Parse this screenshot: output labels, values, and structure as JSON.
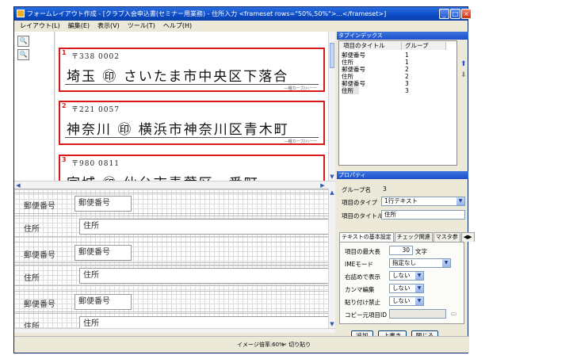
{
  "window": {
    "title": "フォームレイアウト作成 - [クラブ入会申込書(セミナー用業務) - 住所入力 <frameset rows=\"50%,50%\">...</frameset>]",
    "minimize_label": "_",
    "maximize_label": "□",
    "close_label": "×"
  },
  "menu": {
    "items": [
      "レイアウト(L)",
      "編集(E)",
      "表示(V)",
      "ツール(T)",
      "ヘルプ(H)"
    ]
  },
  "image_view": {
    "rows": [
      {
        "num": "1",
        "postal": "〒338 0002",
        "handwriting": "埼玉 ㊞ さいたま市中央区下落合",
        "fine": "―種カーブ/ハーー"
      },
      {
        "num": "2",
        "postal": "〒221 0057",
        "handwriting": "神奈川 ㊞ 横浜市神奈川区青木町",
        "fine": "―種カーブ/ハーー"
      },
      {
        "num": "3",
        "postal": "〒980 0811",
        "handwriting": "宮城 ㊞ 仙台市青葉区一番町",
        "fine": ""
      }
    ]
  },
  "form": {
    "rows": [
      {
        "label": "郵便番号",
        "value": "郵便番号"
      },
      {
        "label": "住所",
        "value": "住所"
      },
      {
        "label": "郵便番号",
        "value": "郵便番号"
      },
      {
        "label": "住所",
        "value": "住所"
      },
      {
        "label": "郵便番号",
        "value": "郵便番号"
      },
      {
        "label": "住所",
        "value": "住所"
      }
    ]
  },
  "status": {
    "zoom": "イメージ倍率:60%",
    "cut": "切り貼り"
  },
  "tab_index": {
    "title": "タブインデックス",
    "col_title": "項目のタイトル",
    "col_group": "グループ",
    "items": [
      {
        "title": "郵便番号",
        "group": "1"
      },
      {
        "title": "住所",
        "group": "1"
      },
      {
        "title": "郵便番号",
        "group": "2"
      },
      {
        "title": "住所",
        "group": "2"
      },
      {
        "title": "郵便番号",
        "group": "3"
      },
      {
        "title": "住所",
        "group": "3"
      }
    ]
  },
  "properties": {
    "title": "プロパティ",
    "group_label": "グループ名",
    "group_value": "3",
    "type_label": "項目のタイプ",
    "type_value": "1行テキスト",
    "item_title_label": "項目のタイトル",
    "item_title_value": "住所",
    "tabs": [
      "テキストの基本設定",
      "チェック関連",
      "マスタ参"
    ],
    "max_len_label": "項目の最大長",
    "max_len_value": "30",
    "max_len_unit": "文字",
    "ime_label": "IMEモード",
    "ime_value": "指定なし",
    "right_label": "右詰めで表示",
    "right_value": "しない",
    "comma_label": "カンマ編集",
    "comma_value": "しない",
    "paste_label": "貼り付け禁止",
    "paste_value": "しない",
    "copy_label": "コピー元項目ID",
    "copy_value": ""
  },
  "buttons": {
    "add": "追加",
    "overwrite": "上書き",
    "close": "閉じる"
  }
}
